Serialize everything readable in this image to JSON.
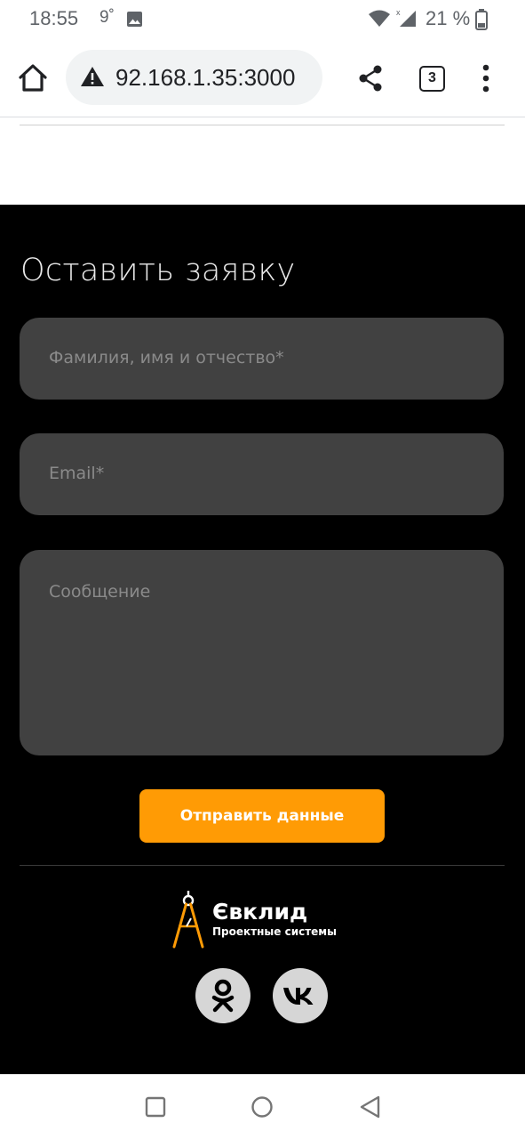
{
  "status_bar": {
    "time": "18:55",
    "temperature": "9˚",
    "battery": "21 %"
  },
  "browser": {
    "url": "92.168.1.35:3000",
    "tab_count": "3",
    "icons": [
      "home-icon",
      "warning-icon",
      "share-icon",
      "tabs-icon",
      "more-vert-icon"
    ]
  },
  "form": {
    "title": "Оставить заявку",
    "name_placeholder": "Фамилия, имя и отчество*",
    "email_placeholder": "Email*",
    "message_placeholder": "Сообщение",
    "submit_label": "Отправить данные"
  },
  "footer": {
    "brand_name": "Євклид",
    "brand_tagline": "Проектные системы",
    "socials": [
      "odnoklassniki-icon",
      "vk-icon"
    ]
  },
  "colors": {
    "accent": "#ff9b05",
    "background": "#000000",
    "field": "#414141"
  }
}
